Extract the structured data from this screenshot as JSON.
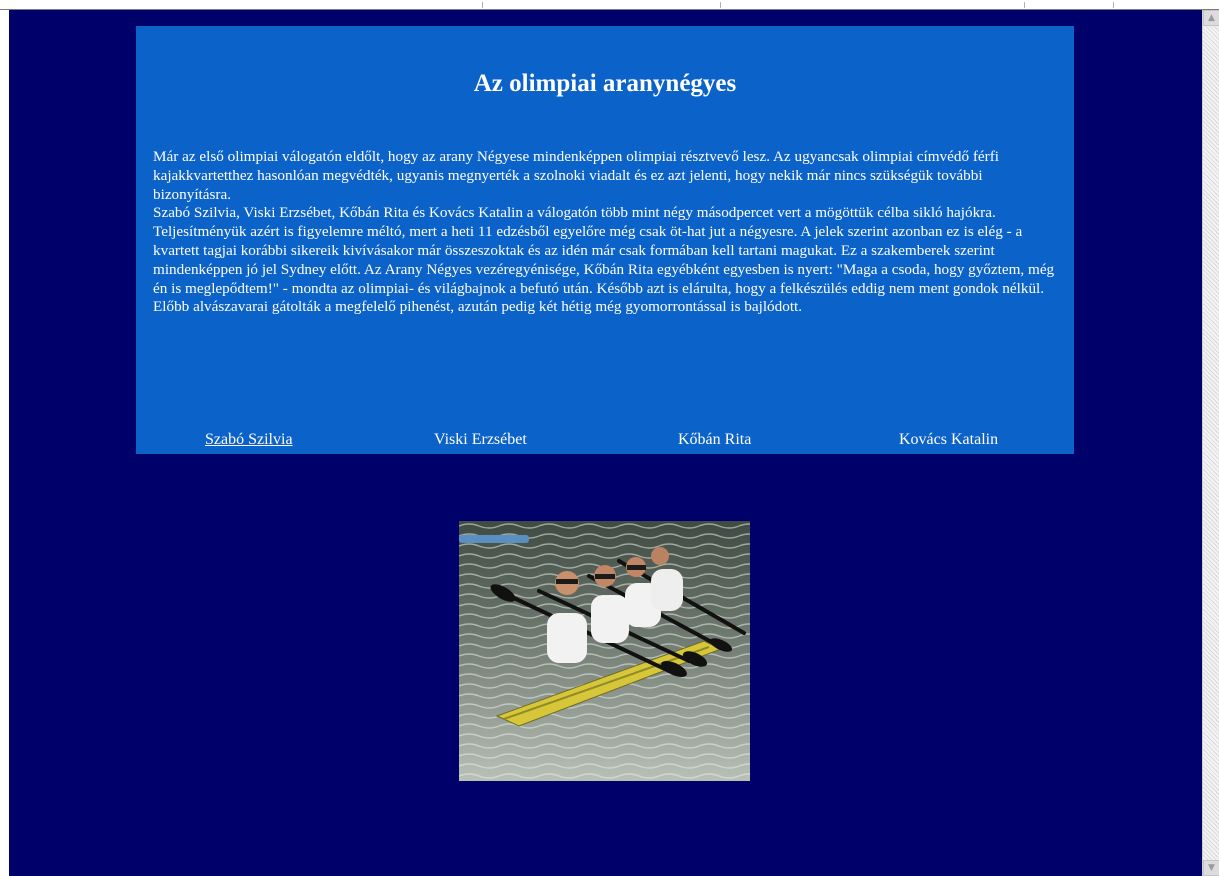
{
  "page": {
    "title": "Az olimpiai aranynégyes",
    "paragraph1": "Már az első olimpiai válogatón eldőlt, hogy az arany Négyese mindenképpen olimpiai résztvevő lesz. Az ugyancsak olimpiai címvédő férfi kajakkvartetthez hasonlóan megvédték, ugyanis megnyerték a szolnoki viadalt és ez azt jelenti, hogy nekik már nincs szükségük további bizonyításra.",
    "paragraph2": "Szabó Szilvia, Viski Erzsébet, Kőbán Rita és Kovács Katalin a válogatón több mint négy másodpercet vert a mögöttük célba sikló hajókra. Teljesítményük azért is figyelemre méltó, mert a heti 11 edzésből egyelőre még csak öt-hat jut a négyesre. A jelek szerint azonban ez is elég - a kvartett tagjai korábbi sikereik kivívásakor már összeszoktak és az idén már csak formában kell tartani magukat. Ez a szakemberek szerint mindenképpen jó jel Sydney előtt. Az Arany Négyes vezéregyénisége, Kőbán Rita egyébként egyesben is nyert: \"Maga a csoda, hogy győztem, még én is meglepődtem!\" - mondta az olimpiai- és világbajnok a befutó után. Később azt is elárulta, hogy a felkészülés eddig nem ment gondok nélkül. Előbb alvászavarai gátolták a megfelelő pihenést, azután pedig két hétig még gyomorrontással is bajlódott."
  },
  "members": {
    "szabo": "Szabó Szilvia",
    "viski": "Viski Erzsébet",
    "koban": "Kőbán Rita",
    "kovacs": "Kovács Katalin"
  },
  "photo": {
    "alt": "four-women-kayak-crew-photo"
  },
  "scrollbar": {
    "up_icon": "triangle-up",
    "down_icon": "triangle-down"
  },
  "colors": {
    "page_background": "#00006b",
    "panel_background": "#0b62c9",
    "text": "#ffffff"
  }
}
